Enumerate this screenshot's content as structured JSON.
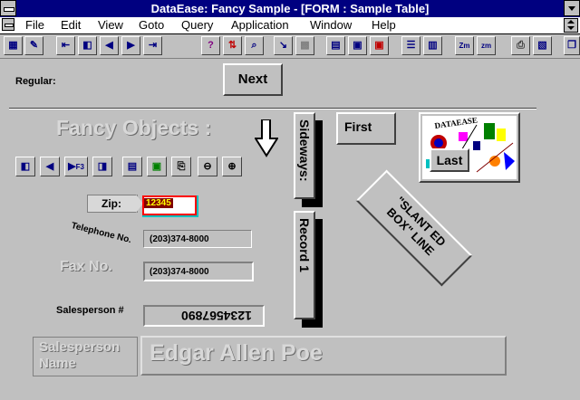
{
  "window": {
    "title": "DataEase: Fancy Sample - [FORM : Sample Table]"
  },
  "menu": {
    "items": [
      "File",
      "Edit",
      "View",
      "Goto",
      "Query",
      "Application",
      "Window",
      "Help"
    ]
  },
  "form": {
    "regular_label": "Regular:",
    "next_button": "Next",
    "fancy_objects": "Fancy Objects :",
    "first_button": "First",
    "last_button": "Last",
    "sideways_button": "Sideways:",
    "record_button": "Record 1",
    "slant_line1": "\"SLANT ED",
    "slant_line2": "BOX\" LINE",
    "nav_f3_sub": "F3",
    "zip_label": "Zip:",
    "zip_value": "12345",
    "telephone_label": "Telephone No.",
    "telephone_value": "(203)374-8000",
    "fax_label": "Fax No.",
    "fax_value": "(203)374-8000",
    "salesperson_num_label": "Salesperson #",
    "salesperson_num_value": "1234567890",
    "salesperson_name_label_1": "Salesperson",
    "salesperson_name_label_2": "Name",
    "salesperson_name_value": "Edgar Allen Poe"
  },
  "colors": {
    "titlebar": "#000080",
    "zip_fill": "#800000",
    "zip_text": "#ffff00",
    "zip_border": "#ff0000"
  },
  "icons": {
    "toolbar": [
      "form-design-icon",
      "pencil-icon",
      "first-record-icon",
      "prev-page-icon",
      "prev-record-icon",
      "next-record-icon",
      "last-record-icon",
      "help-icon",
      "sort-icon",
      "search-icon",
      "cursor-icon",
      "grid-icon",
      "save-icon",
      "save-as-icon",
      "save-color-icon",
      "form-view-icon",
      "table-view-icon",
      "zoom-in-icon",
      "zoom-out-icon",
      "print-icon",
      "print-setup-icon",
      "copy-icon"
    ],
    "nav": [
      "first-icon",
      "prev-icon",
      "next-f3-icon",
      "last-icon",
      "save-icon",
      "save-down-icon",
      "print-icon",
      "delete-icon",
      "insert-icon"
    ]
  }
}
